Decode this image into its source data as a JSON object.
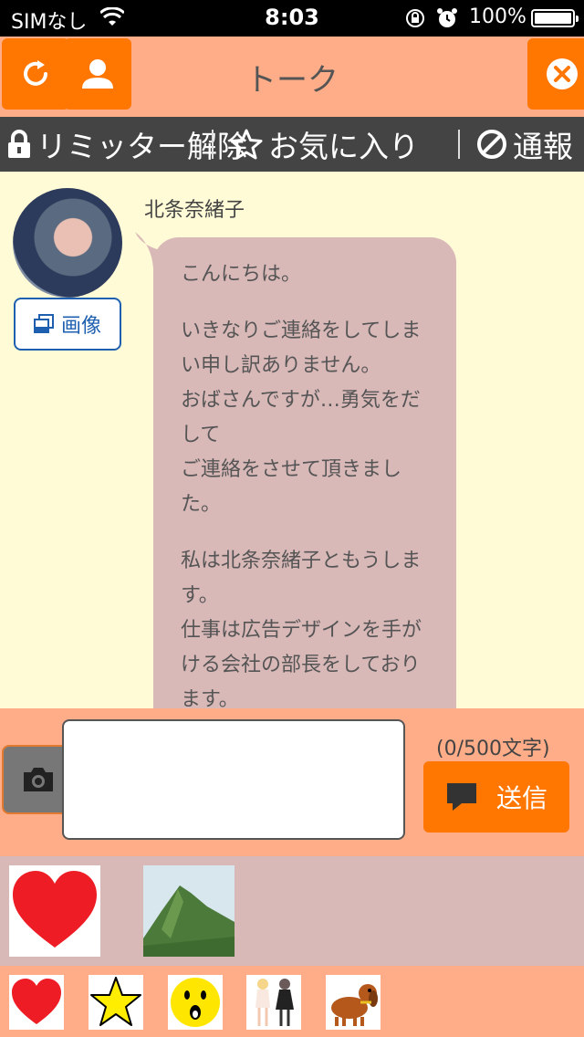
{
  "status_bar": {
    "carrier": "SIMなし",
    "time": "8:03",
    "battery_percent_label": "100%",
    "battery_level": 1.0
  },
  "header": {
    "title": "トーク",
    "buttons": {
      "refresh": "refresh-icon",
      "profile": "person-icon",
      "close": "close-icon"
    }
  },
  "actions": {
    "limiter": "リミッター解除",
    "favorite": "お気に入り",
    "report": "通報"
  },
  "chat": {
    "sender_name": "北条奈緒子",
    "image_button_label": "画像",
    "message_paragraphs": [
      "こんにちは。",
      "いきなりご連絡をしてしまい申し訳ありません。\nおばさんですが…勇気をだして\nご連絡をさせて頂きました。",
      "私は北条奈緒子ともうします。\n仕事は広告デザインを手がける会社の部長をしております。"
    ]
  },
  "composer": {
    "input_value": "",
    "char_counter": "(0/500文字)",
    "send_label": "送信"
  },
  "stamps": {
    "large": [
      "heart-stamp",
      "mountain-stamp"
    ],
    "small": [
      "heart-stamp",
      "star-stamp",
      "surprised-face-stamp",
      "girls-stamp",
      "dog-stamp"
    ]
  },
  "colors": {
    "accent": "#ff7700",
    "header_bg": "#ffad88",
    "chat_bg": "#fffbd6",
    "bubble_bg": "#d9b8b8",
    "action_bar_bg": "#444444",
    "image_button": "#1e5fb0"
  }
}
